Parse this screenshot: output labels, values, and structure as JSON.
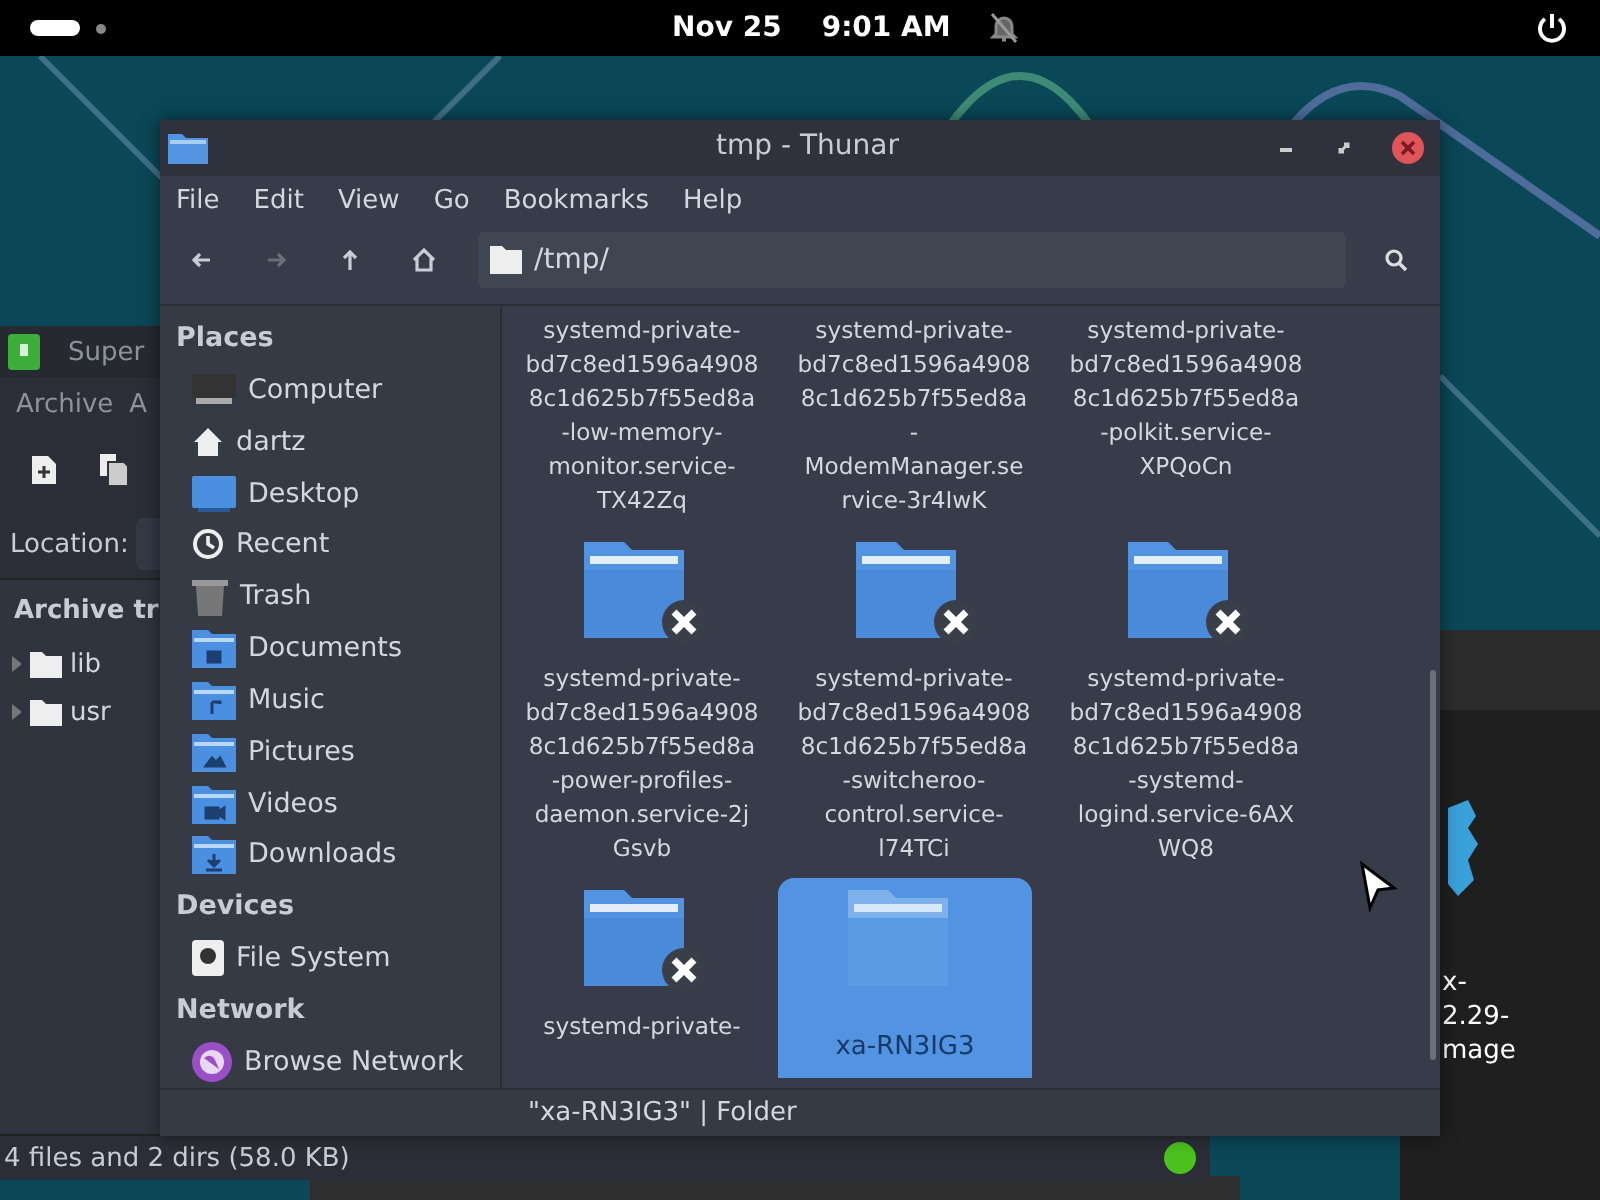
{
  "top_bar": {
    "date": "Nov 25",
    "time": "9:01 AM"
  },
  "back_window": {
    "title": "Super",
    "menu": [
      "Archive",
      "A"
    ],
    "location_label": "Location:",
    "tree_header": "Archive tr",
    "tree": [
      {
        "label": "lib",
        "expanded": false
      },
      {
        "label": "usr",
        "expanded": false
      }
    ],
    "status": "4 files and 2 dirs  (58.0 KB)"
  },
  "right_window": {
    "label_lines": [
      "x-",
      "2.29-",
      "mage"
    ]
  },
  "thunar": {
    "title": "tmp - Thunar",
    "menu": [
      "File",
      "Edit",
      "View",
      "Go",
      "Bookmarks",
      "Help"
    ],
    "nav": [
      {
        "kind": "back",
        "disabled": false
      },
      {
        "kind": "forward",
        "disabled": true
      },
      {
        "kind": "up",
        "disabled": false
      },
      {
        "kind": "home",
        "disabled": false
      }
    ],
    "path": "/tmp/",
    "sections": [
      {
        "header": "Places",
        "items": [
          {
            "label": "Computer",
            "kind": "computer"
          },
          {
            "label": "dartz",
            "kind": "home"
          },
          {
            "label": "Desktop",
            "kind": "desktop"
          },
          {
            "label": "Recent",
            "kind": "recent"
          },
          {
            "label": "Trash",
            "kind": "trash"
          },
          {
            "label": "Documents",
            "kind": "documents"
          },
          {
            "label": "Music",
            "kind": "music"
          },
          {
            "label": "Pictures",
            "kind": "pictures"
          },
          {
            "label": "Videos",
            "kind": "videos"
          },
          {
            "label": "Downloads",
            "kind": "downloads"
          }
        ]
      },
      {
        "header": "Devices",
        "items": [
          {
            "label": "File System",
            "kind": "drive"
          }
        ]
      },
      {
        "header": "Network",
        "items": [
          {
            "label": "Browse Network",
            "kind": "network"
          }
        ]
      }
    ],
    "files": [
      {
        "lines": [
          "systemd-private-",
          "bd7c8ed1596a4908",
          "8c1d625b7f55ed8a",
          "-low-memory-",
          "monitor.service-",
          "TX42Zq"
        ],
        "selected": false
      },
      {
        "lines": [
          "systemd-private-",
          "bd7c8ed1596a4908",
          "8c1d625b7f55ed8a",
          "-",
          "ModemManager.se",
          "rvice-3r4IwK"
        ],
        "selected": false
      },
      {
        "lines": [
          "systemd-private-",
          "bd7c8ed1596a4908",
          "8c1d625b7f55ed8a",
          "-polkit.service-",
          "XPQoCn"
        ],
        "selected": false
      },
      {
        "lines": [
          "systemd-private-",
          "bd7c8ed1596a4908",
          "8c1d625b7f55ed8a",
          "-power-profiles-",
          "daemon.service-2j",
          "Gsvb"
        ],
        "selected": false,
        "kind": "folder",
        "unreadable": true
      },
      {
        "lines": [
          "systemd-private-",
          "bd7c8ed1596a4908",
          "8c1d625b7f55ed8a",
          "-switcheroo-",
          "control.service-",
          "l74TCi"
        ],
        "selected": false,
        "kind": "folder",
        "unreadable": true
      },
      {
        "lines": [
          "systemd-private-",
          "bd7c8ed1596a4908",
          "8c1d625b7f55ed8a",
          "-systemd-",
          "logind.service-6AX",
          "WQ8"
        ],
        "selected": false,
        "kind": "folder",
        "unreadable": true
      },
      {
        "lines": [
          "systemd-private-"
        ],
        "selected": false,
        "kind": "folder",
        "unreadable": true
      },
      {
        "lines": [
          "xa-RN3IG3"
        ],
        "selected": true,
        "kind": "folder",
        "unreadable": false
      }
    ],
    "status": "\"xa-RN3IG3\"  |  Folder"
  }
}
